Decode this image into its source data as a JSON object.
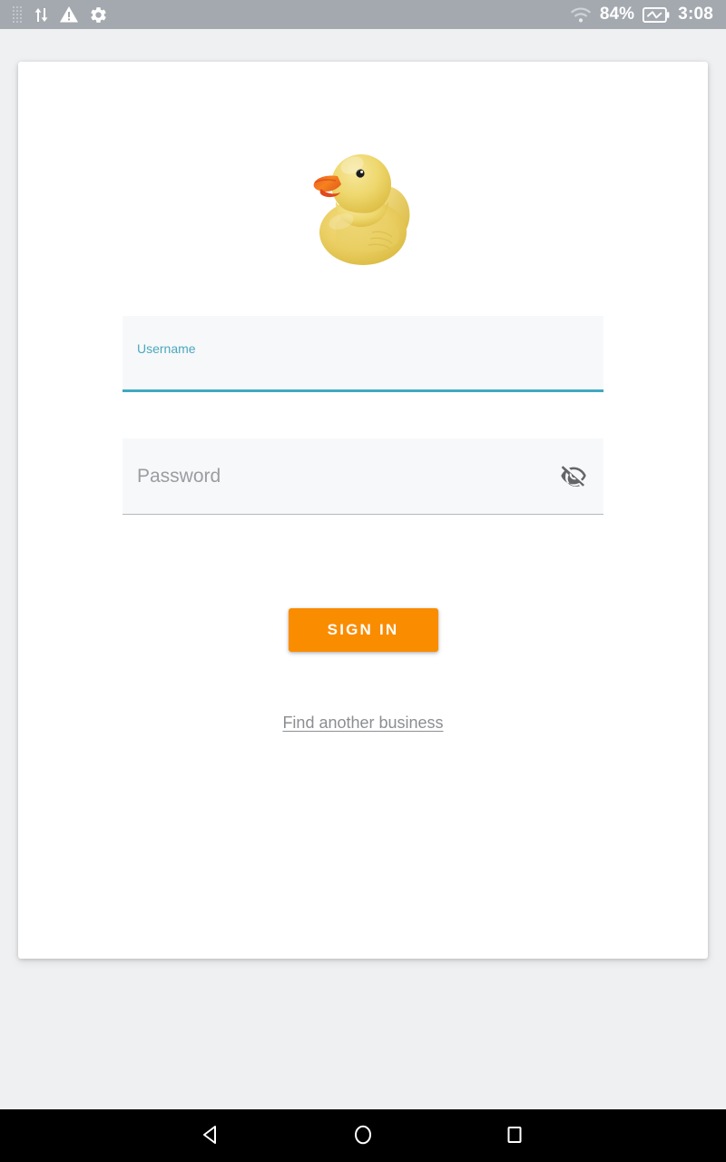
{
  "status_bar": {
    "background_color": "#A4A9B0",
    "left_icons": [
      {
        "name": "dotted-grid-icon",
        "label": ""
      },
      {
        "name": "data-transfer-icon",
        "label": ""
      },
      {
        "name": "warning-triangle-icon",
        "label": ""
      },
      {
        "name": "gear-icon",
        "label": ""
      }
    ],
    "wifi_icon": "wifi-icon",
    "battery_percent": "84%",
    "battery_icon": "battery-charging-icon",
    "clock": "3:08"
  },
  "login_card": {
    "logo": {
      "icon": "rubber-duck-logo",
      "alt": "Rubber duck logo"
    },
    "username_field": {
      "label": "Username",
      "value": "",
      "placeholder": "Username",
      "focused": true,
      "accent_color": "#3FA9C0"
    },
    "password_field": {
      "label": "Password",
      "value": "",
      "placeholder": "Password",
      "focused": false,
      "toggle_icon": "eye-off-icon",
      "underline_color": "#B6B8BB"
    },
    "sign_in_button": {
      "label": "SIGN IN",
      "color": "#FA8C00",
      "text_color": "#FFFFFF"
    },
    "find_business_link": {
      "label": "Find another business",
      "color": "#8B8E92"
    },
    "card_background": "#FFFFFF",
    "page_background": "#EFF0F2"
  },
  "nav_bar": {
    "background_color": "#000000",
    "buttons": [
      {
        "name": "back-button",
        "icon": "triangle-left-icon"
      },
      {
        "name": "home-button",
        "icon": "circle-icon"
      },
      {
        "name": "recents-button",
        "icon": "square-icon"
      }
    ]
  }
}
